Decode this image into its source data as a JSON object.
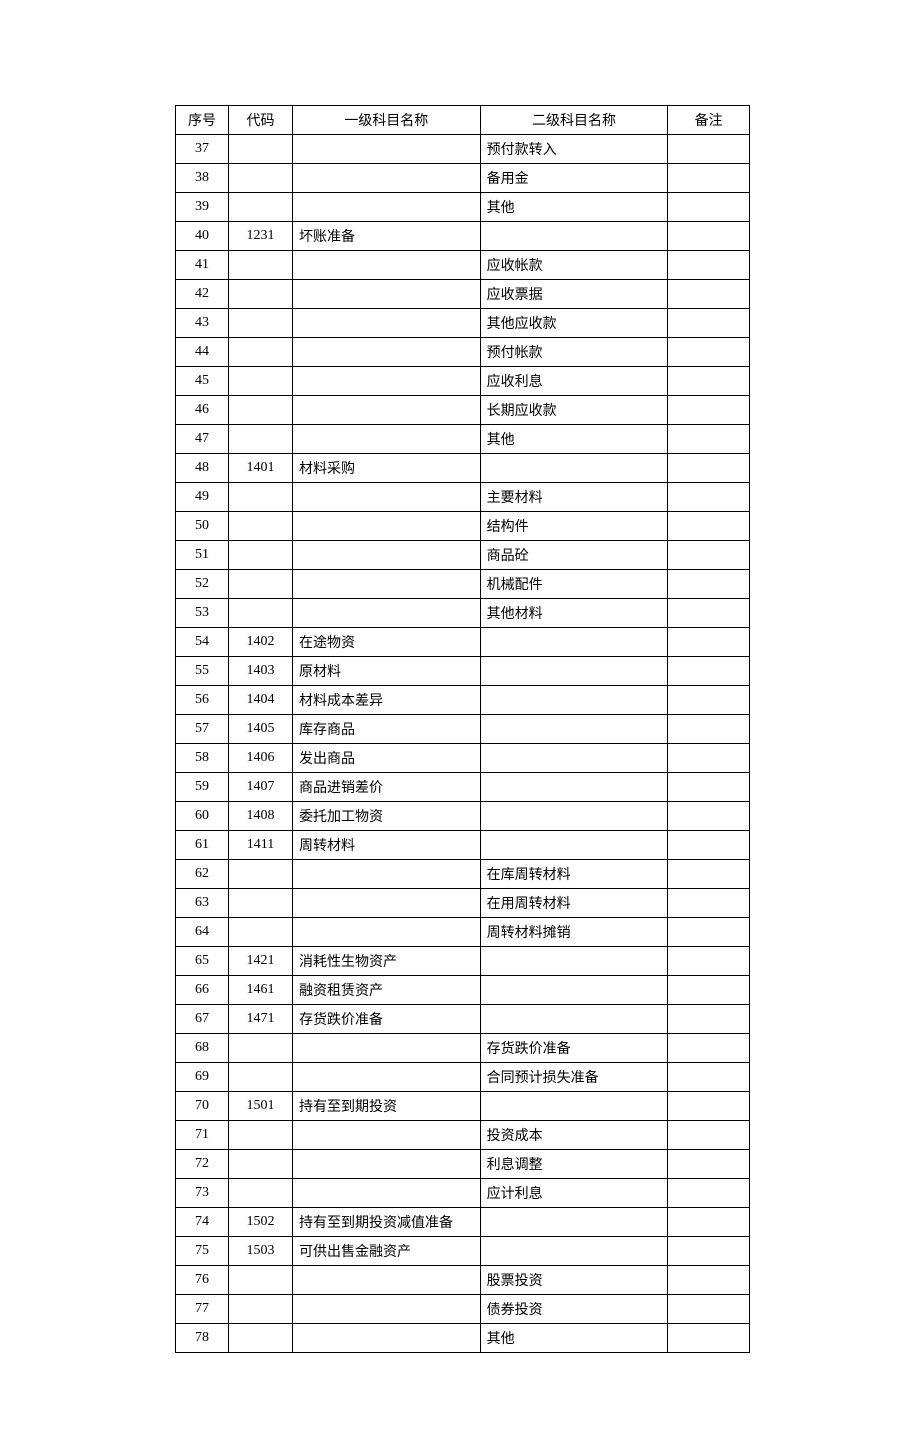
{
  "headers": {
    "seq": "序号",
    "code": "代码",
    "lvl1": "一级科目名称",
    "lvl2": "二级科目名称",
    "remark": "备注"
  },
  "rows": [
    {
      "seq": "37",
      "code": "",
      "lvl1": "",
      "lvl2": "预付款转入",
      "remark": ""
    },
    {
      "seq": "38",
      "code": "",
      "lvl1": "",
      "lvl2": "备用金",
      "remark": ""
    },
    {
      "seq": "39",
      "code": "",
      "lvl1": "",
      "lvl2": "其他",
      "remark": ""
    },
    {
      "seq": "40",
      "code": "1231",
      "lvl1": "坏账准备",
      "lvl2": "",
      "remark": ""
    },
    {
      "seq": "41",
      "code": "",
      "lvl1": "",
      "lvl2": "应收帐款",
      "remark": ""
    },
    {
      "seq": "42",
      "code": "",
      "lvl1": "",
      "lvl2": "应收票据",
      "remark": ""
    },
    {
      "seq": "43",
      "code": "",
      "lvl1": "",
      "lvl2": "其他应收款",
      "remark": ""
    },
    {
      "seq": "44",
      "code": "",
      "lvl1": "",
      "lvl2": "预付帐款",
      "remark": ""
    },
    {
      "seq": "45",
      "code": "",
      "lvl1": "",
      "lvl2": "应收利息",
      "remark": ""
    },
    {
      "seq": "46",
      "code": "",
      "lvl1": "",
      "lvl2": "长期应收款",
      "remark": ""
    },
    {
      "seq": "47",
      "code": "",
      "lvl1": "",
      "lvl2": "其他",
      "remark": ""
    },
    {
      "seq": "48",
      "code": "1401",
      "lvl1": "材料采购",
      "lvl2": "",
      "remark": ""
    },
    {
      "seq": "49",
      "code": "",
      "lvl1": "",
      "lvl2": "主要材料",
      "remark": ""
    },
    {
      "seq": "50",
      "code": "",
      "lvl1": "",
      "lvl2": "结构件",
      "remark": ""
    },
    {
      "seq": "51",
      "code": "",
      "lvl1": "",
      "lvl2": "商品砼",
      "remark": ""
    },
    {
      "seq": "52",
      "code": "",
      "lvl1": "",
      "lvl2": "机械配件",
      "remark": ""
    },
    {
      "seq": "53",
      "code": "",
      "lvl1": "",
      "lvl2": "其他材料",
      "remark": ""
    },
    {
      "seq": "54",
      "code": "1402",
      "lvl1": "在途物资",
      "lvl2": "",
      "remark": ""
    },
    {
      "seq": "55",
      "code": "1403",
      "lvl1": "原材料",
      "lvl2": "",
      "remark": ""
    },
    {
      "seq": "56",
      "code": "1404",
      "lvl1": "材料成本差异",
      "lvl2": "",
      "remark": ""
    },
    {
      "seq": "57",
      "code": "1405",
      "lvl1": "库存商品",
      "lvl2": "",
      "remark": ""
    },
    {
      "seq": "58",
      "code": "1406",
      "lvl1": "发出商品",
      "lvl2": "",
      "remark": ""
    },
    {
      "seq": "59",
      "code": "1407",
      "lvl1": "商品进销差价",
      "lvl2": "",
      "remark": ""
    },
    {
      "seq": "60",
      "code": "1408",
      "lvl1": "委托加工物资",
      "lvl2": "",
      "remark": ""
    },
    {
      "seq": "61",
      "code": "1411",
      "lvl1": "周转材料",
      "lvl2": "",
      "remark": ""
    },
    {
      "seq": "62",
      "code": "",
      "lvl1": "",
      "lvl2": "在库周转材料",
      "remark": ""
    },
    {
      "seq": "63",
      "code": "",
      "lvl1": "",
      "lvl2": "在用周转材料",
      "remark": ""
    },
    {
      "seq": "64",
      "code": "",
      "lvl1": "",
      "lvl2": "周转材料摊销",
      "remark": ""
    },
    {
      "seq": "65",
      "code": "1421",
      "lvl1": "消耗性生物资产",
      "lvl2": "",
      "remark": ""
    },
    {
      "seq": "66",
      "code": "1461",
      "lvl1": "融资租赁资产",
      "lvl2": "",
      "remark": ""
    },
    {
      "seq": "67",
      "code": "1471",
      "lvl1": "存货跌价准备",
      "lvl2": "",
      "remark": ""
    },
    {
      "seq": "68",
      "code": "",
      "lvl1": "",
      "lvl2": "存货跌价准备",
      "remark": ""
    },
    {
      "seq": "69",
      "code": "",
      "lvl1": "",
      "lvl2": "合同预计损失准备",
      "remark": ""
    },
    {
      "seq": "70",
      "code": "1501",
      "lvl1": "持有至到期投资",
      "lvl2": "",
      "remark": ""
    },
    {
      "seq": "71",
      "code": "",
      "lvl1": "",
      "lvl2": "投资成本",
      "remark": ""
    },
    {
      "seq": "72",
      "code": "",
      "lvl1": "",
      "lvl2": "利息调整",
      "remark": ""
    },
    {
      "seq": "73",
      "code": "",
      "lvl1": "",
      "lvl2": "应计利息",
      "remark": ""
    },
    {
      "seq": "74",
      "code": "1502",
      "lvl1": "持有至到期投资减值准备",
      "lvl2": "",
      "remark": ""
    },
    {
      "seq": "75",
      "code": "1503",
      "lvl1": "可供出售金融资产",
      "lvl2": "",
      "remark": ""
    },
    {
      "seq": "76",
      "code": "",
      "lvl1": "",
      "lvl2": "股票投资",
      "remark": ""
    },
    {
      "seq": "77",
      "code": "",
      "lvl1": "",
      "lvl2": "债券投资",
      "remark": ""
    },
    {
      "seq": "78",
      "code": "",
      "lvl1": "",
      "lvl2": "其他",
      "remark": ""
    }
  ]
}
